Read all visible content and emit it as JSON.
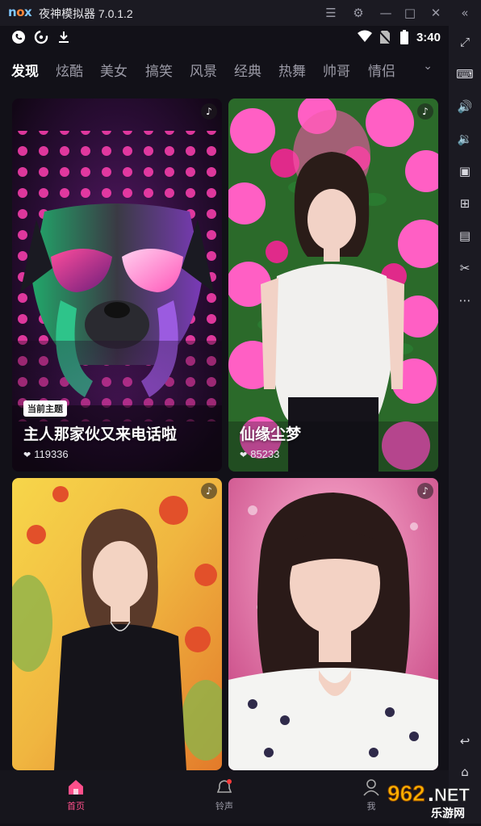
{
  "emulator": {
    "logo": {
      "n": "n",
      "o": "o",
      "x": "x"
    },
    "title": "夜神模拟器 7.0.1.2",
    "controls": [
      "menu-icon",
      "settings-icon",
      "minimize-icon",
      "maximize-icon",
      "close-icon",
      "collapse-sidebar-icon"
    ]
  },
  "statusbar": {
    "time": "3:40",
    "left_icons": [
      "phone-icon",
      "swirl-icon",
      "download-icon"
    ],
    "right_icons": [
      "wifi-icon",
      "no-sim-icon",
      "battery-icon"
    ]
  },
  "tabs": {
    "items": [
      "发现",
      "炫酷",
      "美女",
      "搞笑",
      "风景",
      "经典",
      "热舞",
      "帅哥",
      "情侣"
    ],
    "active": "发现",
    "more_icon": "chevron-down-icon"
  },
  "cards": [
    {
      "badge": "当前主题",
      "title": "主人那家伙又来电话啦",
      "likes": "119336",
      "icon": "music-note-icon"
    },
    {
      "badge": "",
      "title": "仙缘尘梦",
      "likes": "85233",
      "icon": "music-note-icon"
    },
    {
      "badge": "",
      "title": "",
      "likes": "",
      "icon": "music-note-icon"
    },
    {
      "badge": "",
      "title": "",
      "likes": "",
      "icon": "music-note-icon"
    }
  ],
  "bottom_nav": {
    "home": "首页",
    "ringtone": "铃声",
    "profile": "我"
  },
  "sidebar": {
    "icons": [
      "fullscreen-icon",
      "keyboard-icon",
      "volume-up-icon",
      "volume-down-icon",
      "screen-icon",
      "apk-install-icon",
      "multi-instance-icon",
      "scissors-icon",
      "more-icon",
      "back-icon",
      "home-icon"
    ]
  },
  "watermark": {
    "number": "962",
    "dot": ".",
    "net": "NET",
    "label": "乐游网"
  },
  "colors": {
    "accent_pink": "#ff4f8b",
    "background": "#121118"
  }
}
